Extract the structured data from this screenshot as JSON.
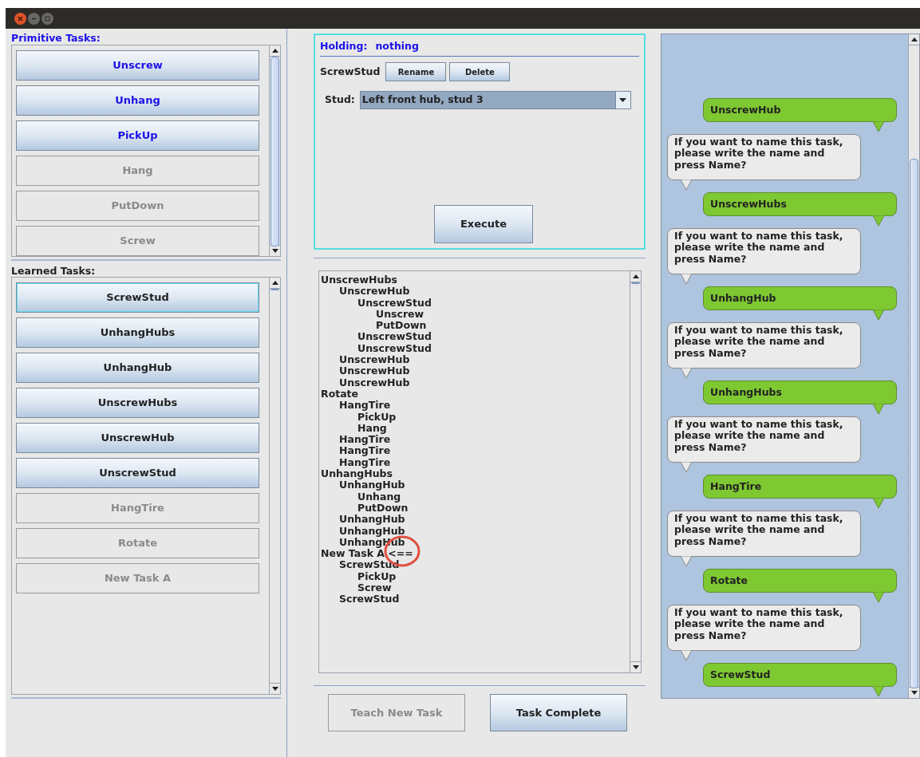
{
  "primitive_tasks": {
    "title": "Primitive Tasks:",
    "items": [
      {
        "label": "Unscrew",
        "enabled": true
      },
      {
        "label": "Unhang",
        "enabled": true
      },
      {
        "label": "PickUp",
        "enabled": true
      },
      {
        "label": "Hang",
        "enabled": false
      },
      {
        "label": "PutDown",
        "enabled": false
      },
      {
        "label": "Screw",
        "enabled": false
      }
    ]
  },
  "learned_tasks": {
    "title": "Learned Tasks:",
    "items": [
      {
        "label": "ScrewStud",
        "enabled": true,
        "focused": true
      },
      {
        "label": "UnhangHubs",
        "enabled": true,
        "focused": false
      },
      {
        "label": "UnhangHub",
        "enabled": true,
        "focused": false
      },
      {
        "label": "UnscrewHubs",
        "enabled": true,
        "focused": false
      },
      {
        "label": "UnscrewHub",
        "enabled": true,
        "focused": false
      },
      {
        "label": "UnscrewStud",
        "enabled": true,
        "focused": false
      },
      {
        "label": "HangTire",
        "enabled": false,
        "focused": false
      },
      {
        "label": "Rotate",
        "enabled": false,
        "focused": false
      },
      {
        "label": "New Task A",
        "enabled": false,
        "focused": false
      }
    ]
  },
  "task_panel": {
    "holding_label": "Holding:",
    "holding_value": "nothing",
    "task_name": "ScrewStud",
    "buttons": [
      "Rename",
      "Delete"
    ],
    "parameter_label": "Stud:",
    "parameter_value": "Left front hub, stud 3",
    "execute": "Execute"
  },
  "task_tree": [
    {
      "label": "UnscrewHubs",
      "children": [
        {
          "label": "UnscrewHub",
          "children": [
            {
              "label": "UnscrewStud",
              "children": [
                {
                  "label": "Unscrew"
                },
                {
                  "label": "PutDown"
                }
              ]
            },
            {
              "label": "UnscrewStud"
            },
            {
              "label": "UnscrewStud"
            }
          ]
        },
        {
          "label": "UnscrewHub"
        },
        {
          "label": "UnscrewHub"
        },
        {
          "label": "UnscrewHub"
        }
      ]
    },
    {
      "label": "Rotate",
      "children": [
        {
          "label": "HangTire",
          "children": [
            {
              "label": "PickUp"
            },
            {
              "label": "Hang"
            }
          ]
        },
        {
          "label": "HangTire"
        },
        {
          "label": "HangTire"
        },
        {
          "label": "HangTire"
        }
      ]
    },
    {
      "label": "UnhangHubs",
      "children": [
        {
          "label": "UnhangHub",
          "children": [
            {
              "label": "Unhang"
            },
            {
              "label": "PutDown"
            }
          ]
        },
        {
          "label": "UnhangHub"
        },
        {
          "label": "UnhangHub"
        },
        {
          "label": "UnhangHub"
        }
      ]
    },
    {
      "label": "New Task A <==",
      "children": [
        {
          "label": "ScrewStud",
          "children": [
            {
              "label": "PickUp"
            },
            {
              "label": "Screw"
            }
          ]
        },
        {
          "label": "ScrewStud"
        }
      ]
    }
  ],
  "bottom_buttons": [
    {
      "label": "Teach New Task",
      "enabled": false
    },
    {
      "label": "Task Complete",
      "enabled": true
    }
  ],
  "chat": [
    {
      "kind": "user",
      "text": "UnscrewHub"
    },
    {
      "kind": "system",
      "text": "If you want to name this task, please write the name and press Name?"
    },
    {
      "kind": "user",
      "text": "UnscrewHubs"
    },
    {
      "kind": "system",
      "text": "If you want to name this task, please write the name and press Name?"
    },
    {
      "kind": "user",
      "text": "UnhangHub"
    },
    {
      "kind": "system",
      "text": "If you want to name this task, please write the name and press Name?"
    },
    {
      "kind": "user",
      "text": "UnhangHubs"
    },
    {
      "kind": "system",
      "text": "If you want to name this task, please write the name and press Name?"
    },
    {
      "kind": "user",
      "text": "HangTire"
    },
    {
      "kind": "system",
      "text": "If you want to name this task, please write the name and press Name?"
    },
    {
      "kind": "user",
      "text": "Rotate"
    },
    {
      "kind": "system",
      "text": "If you want to name this task, please write the name and press Name?"
    },
    {
      "kind": "user",
      "text": "ScrewStud"
    }
  ]
}
